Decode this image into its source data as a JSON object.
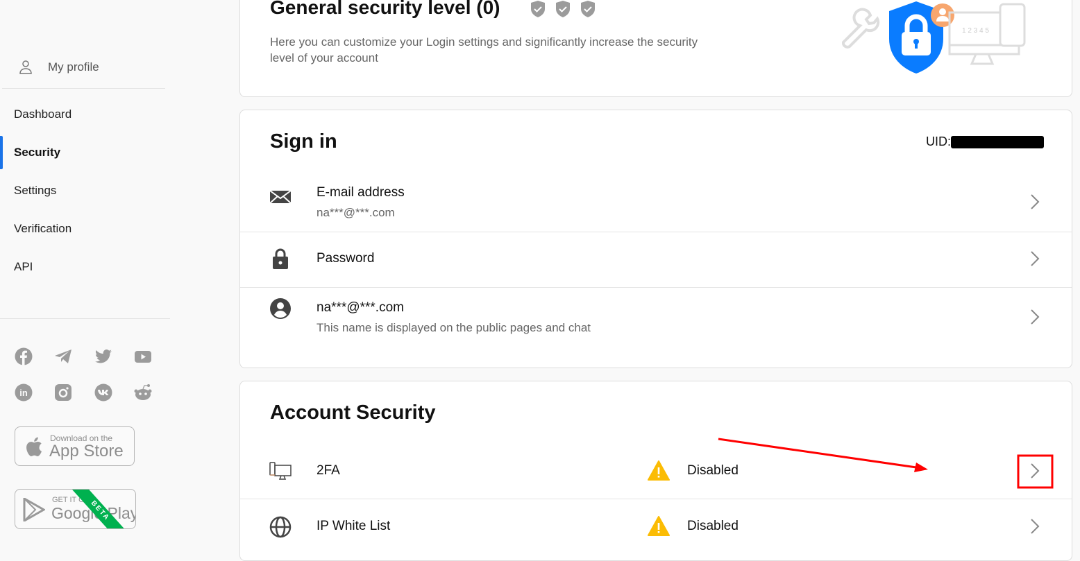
{
  "sidebar": {
    "profile": "My profile",
    "items": [
      {
        "label": "Dashboard"
      },
      {
        "label": "Security",
        "active": true
      },
      {
        "label": "Settings"
      },
      {
        "label": "Verification"
      },
      {
        "label": "API"
      }
    ],
    "social": [
      "facebook-icon",
      "telegram-icon",
      "twitter-icon",
      "youtube-icon",
      "linkedin-icon",
      "instagram-icon",
      "vk-icon",
      "reddit-icon"
    ],
    "app_store": {
      "small": "Download on the",
      "big": "App Store"
    },
    "google_play": {
      "small": "GET IT ON",
      "big": "Google Play",
      "badge": "BETA"
    }
  },
  "security_level": {
    "title": "General security level (0)",
    "description": "Here you can customize your Login settings and significantly increase the security level of your account",
    "illustration_digits": "1 2 3 4 5"
  },
  "sign_in": {
    "title": "Sign in",
    "uid_label": "UID:",
    "rows": [
      {
        "label": "E-mail address",
        "sub": "na***@***.com"
      },
      {
        "label": "Password"
      },
      {
        "label": "na***@***.com",
        "sub": "This name is displayed on the public pages and chat"
      }
    ]
  },
  "account_security": {
    "title": "Account Security",
    "rows": [
      {
        "label": "2FA",
        "status": "Disabled"
      },
      {
        "label": "IP White List",
        "status": "Disabled"
      }
    ]
  },
  "colors": {
    "accent": "#1a73e8",
    "warning": "#fbbc04",
    "annotation": "#ff0000",
    "shield": "#0a7cff",
    "avatar": "#f7a66e"
  }
}
